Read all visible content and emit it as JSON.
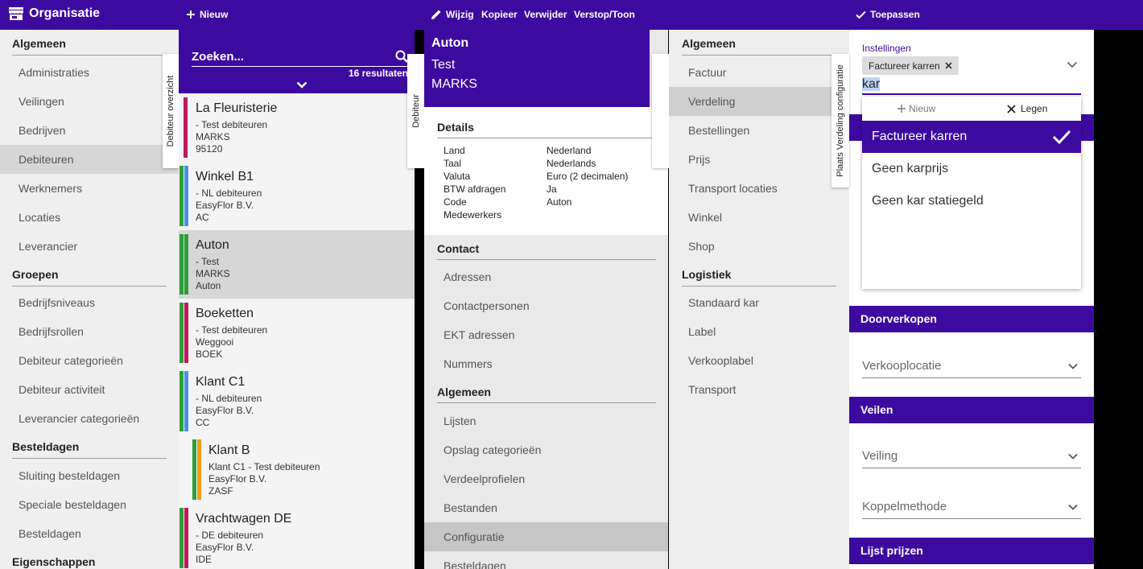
{
  "topbar": {
    "app_title": "Organisatie",
    "new_label": "Nieuw",
    "edit_label": "Wijzig",
    "copy_label": "Kopieer",
    "delete_label": "Verwijder",
    "hide_label": "Verstop/Toon",
    "apply_label": "Toepassen"
  },
  "nav": {
    "sections": [
      {
        "title": "Algemeen",
        "items": [
          "Administraties",
          "Veilingen",
          "Bedrijven",
          "Debiteuren",
          "Werknemers",
          "Locaties",
          "Leverancier"
        ]
      },
      {
        "title": "Groepen",
        "items": [
          "Bedrijfsniveaus",
          "Bedrijfsrollen",
          "Debiteur categorieën",
          "Debiteur activiteit",
          "Leverancier categorieën"
        ]
      },
      {
        "title": "Besteldagen",
        "items": [
          "Sluiting besteldagen",
          "Speciale besteldagen",
          "Besteldagen"
        ]
      },
      {
        "title": "Eigenschappen",
        "items": []
      }
    ],
    "selected": "Debiteuren"
  },
  "side_tabs": {
    "overview": "Debiteur overzicht",
    "debtor": "Debiteur",
    "config": "Plaats Verdeling configuratie"
  },
  "search": {
    "placeholder": "Zoeken...",
    "result_count": "16 resultaten"
  },
  "records": [
    {
      "name": "La Fleuristerie",
      "lines": [
        "- Test debiteuren",
        "MARKS",
        "95120"
      ],
      "colors": [
        "#c2185b"
      ],
      "indent": 0
    },
    {
      "name": "Winkel B1",
      "lines": [
        "- NL debiteuren",
        "EasyFlor B.V.",
        "AC"
      ],
      "colors": [
        "#2e9e3a",
        "#4a90e2"
      ],
      "indent": 0
    },
    {
      "name": "Auton",
      "lines": [
        "- Test",
        "MARKS",
        "Auton"
      ],
      "colors": [
        "#2e9e3a",
        "#2e9e3a"
      ],
      "indent": 0,
      "selected": true
    },
    {
      "name": "Boeketten",
      "lines": [
        "- Test debiteuren",
        "Weggooi",
        "BOEK"
      ],
      "colors": [
        "#2e9e3a",
        "#c2185b"
      ],
      "indent": 0
    },
    {
      "name": "Klant C1",
      "lines": [
        "- NL debiteuren",
        "EasyFlor B.V.",
        "CC"
      ],
      "colors": [
        "#2e9e3a",
        "#4a90e2"
      ],
      "indent": 0
    },
    {
      "name": "Klant B",
      "lines": [
        "Klant C1 - Test debiteuren",
        "EasyFlor B.V.",
        "ZASF"
      ],
      "colors": [
        "#2e9e3a",
        "#f39c12"
      ],
      "indent": 1
    },
    {
      "name": "Vrachtwagen DE",
      "lines": [
        "- DE debiteuren",
        "EasyFlor B.V.",
        "IDE"
      ],
      "colors": [
        "#2e9e3a",
        "#c2185b"
      ],
      "indent": 0
    }
  ],
  "detail": {
    "title": "Auton",
    "subtitle": "Test",
    "company": "MARKS",
    "details_title": "Details",
    "fields": [
      {
        "label": "Land",
        "value": "Nederland"
      },
      {
        "label": "Taal",
        "value": "Nederlands"
      },
      {
        "label": "Valuta",
        "value": "Euro (2 decimalen)"
      },
      {
        "label": "BTW afdragen",
        "value": "Ja"
      },
      {
        "label": "Code",
        "value": "Auton"
      },
      {
        "label": "Medewerkers",
        "value": ""
      }
    ],
    "contact_title": "Contact",
    "contact_items": [
      "Adressen",
      "Contactpersonen",
      "EKT adressen",
      "Nummers"
    ],
    "general_title": "Algemeen",
    "general_items": [
      "Lijsten",
      "Opslag categorieën",
      "Verdeelprofielen",
      "Bestanden",
      "Configuratie",
      "Besteldagen"
    ],
    "selected": "Configuratie"
  },
  "subnav": {
    "general_title": "Algemeen",
    "general_items": [
      "Factuur",
      "Verdeling",
      "Bestellingen",
      "Prijs",
      "Transport locaties",
      "Winkel",
      "Shop"
    ],
    "logistics_title": "Logistiek",
    "logistics_items": [
      "Standaard kar",
      "Label",
      "Verkooplabel",
      "Transport"
    ],
    "selected": "Verdeling"
  },
  "config": {
    "settings_label": "Instellingen",
    "chip": "Factureer karren",
    "typed": "kar",
    "dd_new": "Nieuw",
    "dd_clear": "Legen",
    "options": [
      "Factureer karren",
      "Geen karprijs",
      "Geen kar statiegeld"
    ],
    "selected_option": "Factureer karren",
    "band_resell": "Doorverkopen",
    "sales_location": "Verkooplocatie",
    "band_auction": "Veilen",
    "auction": "Veiling",
    "link_method": "Koppelmethode",
    "band_prices": "Lijst prijzen"
  },
  "colors": {
    "accent": "#3d0aa0"
  }
}
